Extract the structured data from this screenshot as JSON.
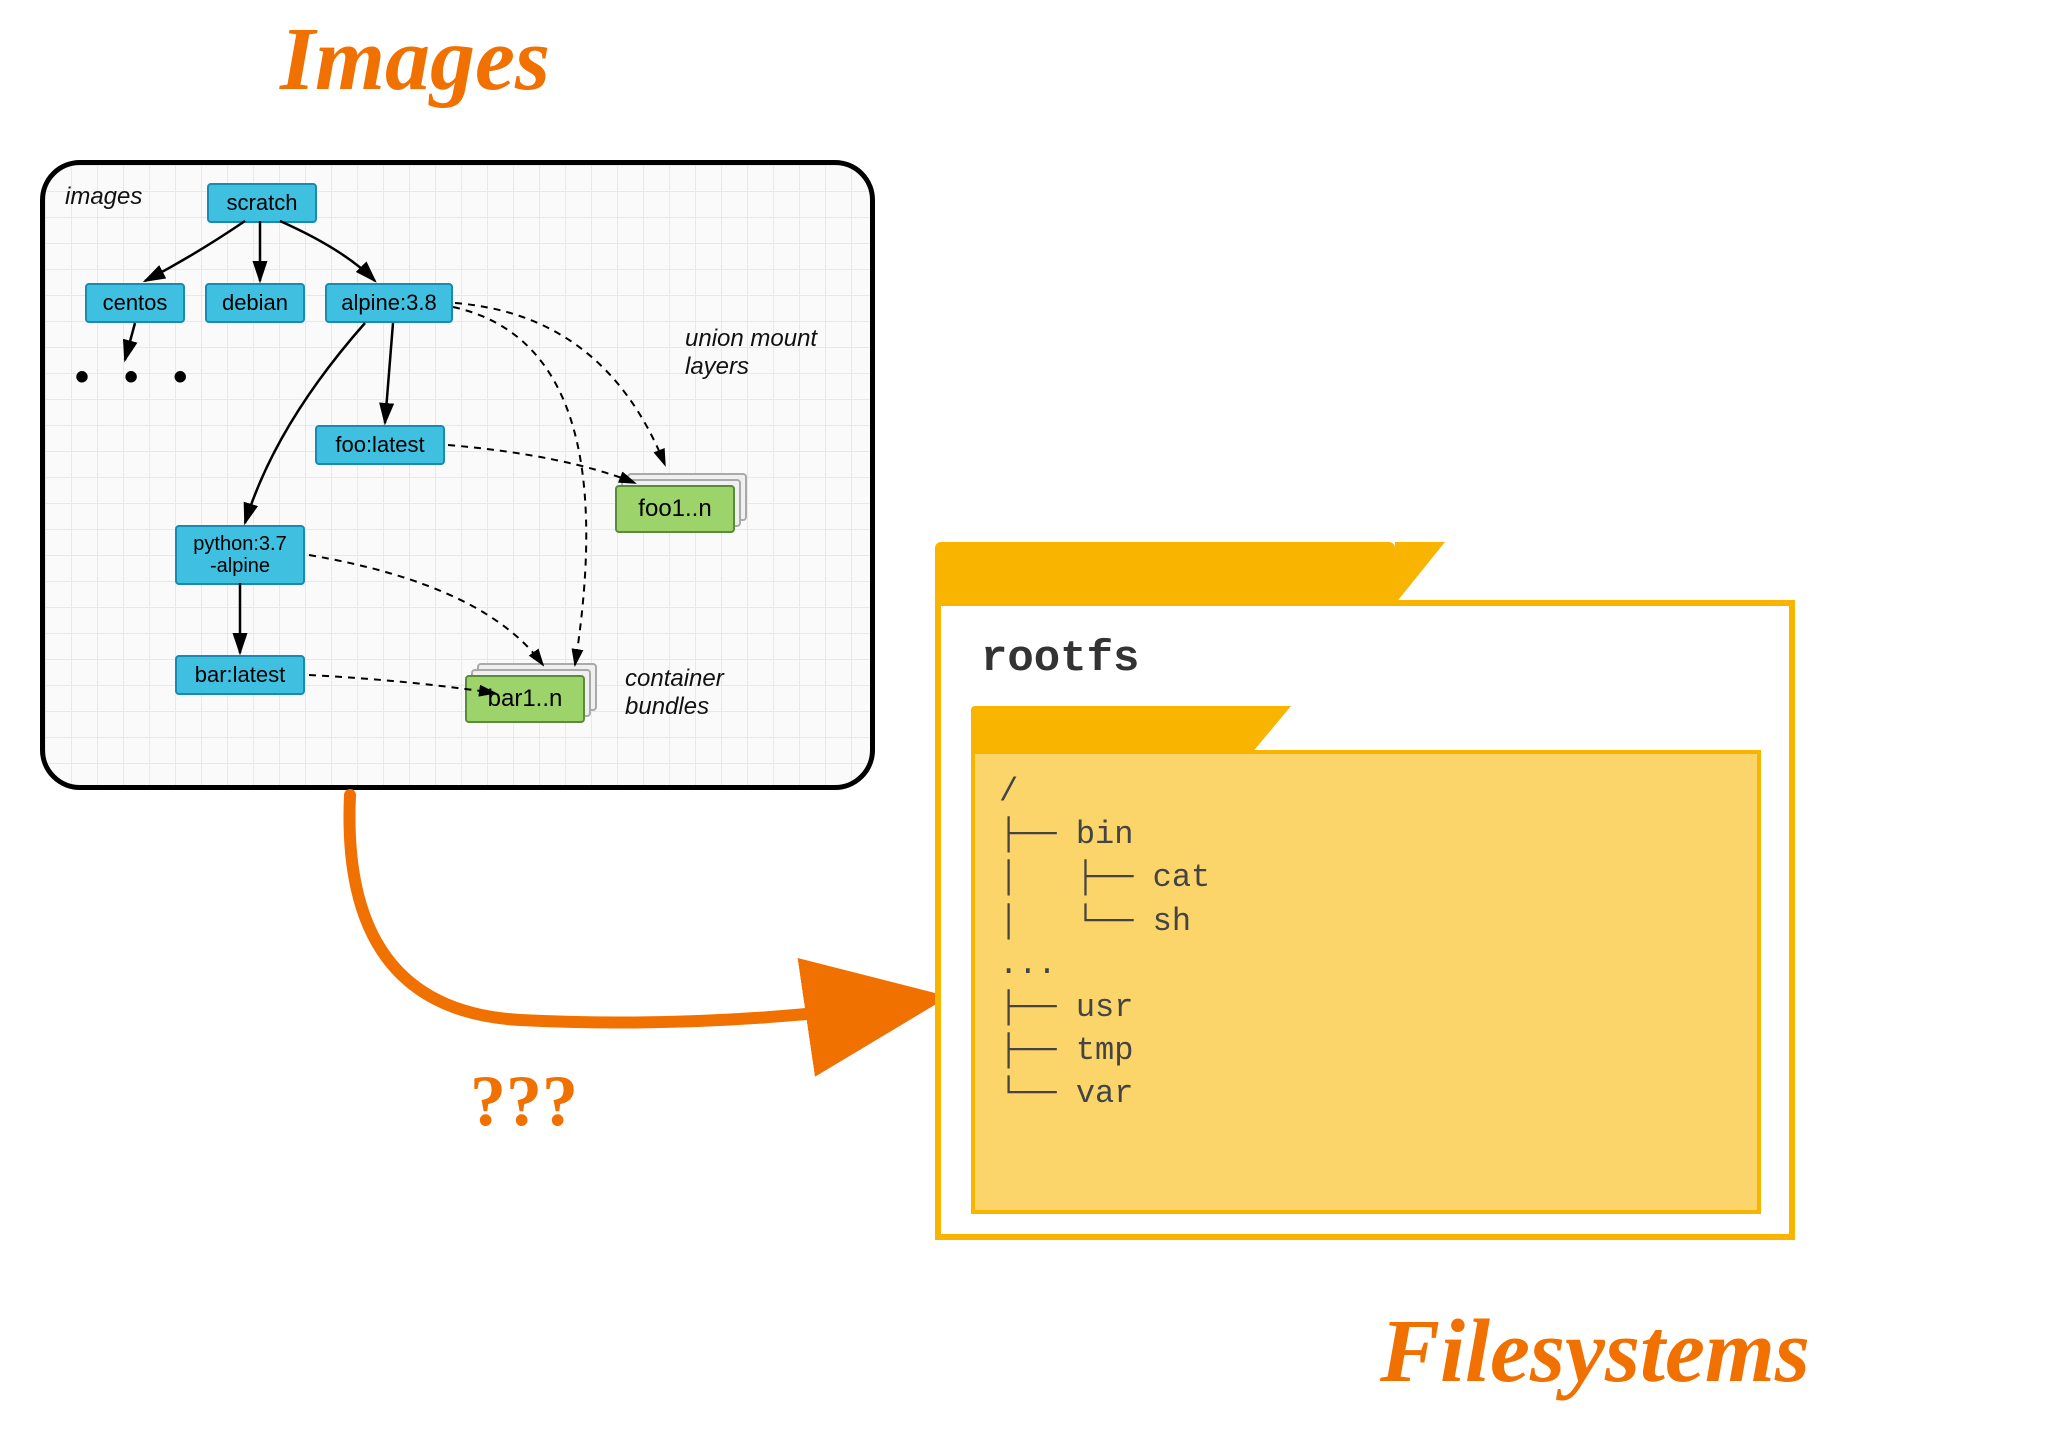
{
  "titles": {
    "images": "Images",
    "filesystems": "Filesystems",
    "question": "???"
  },
  "images_panel": {
    "label": "images",
    "annotations": {
      "union_mount": "union mount\nlayers",
      "container_bundles": "container\nbundles"
    },
    "ellipsis": "• • •",
    "nodes": {
      "scratch": "scratch",
      "centos": "centos",
      "debian": "debian",
      "alpine": "alpine:3.8",
      "foo_latest": "foo:latest",
      "python_alpine": "python:3.7\n-alpine",
      "bar_latest": "bar:latest"
    },
    "bundles": {
      "foo": "foo1..n",
      "bar": "bar1..n"
    }
  },
  "filesystem": {
    "title": "rootfs",
    "tree_lines": [
      "/",
      "├── bin",
      "│   ├── cat",
      "│   └── sh",
      "...",
      "├── usr",
      "├── tmp",
      "└── var"
    ]
  }
}
